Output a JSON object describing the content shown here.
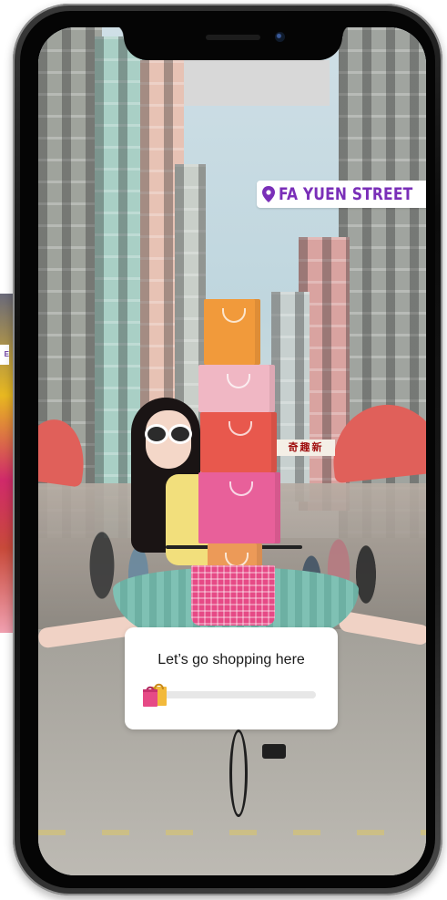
{
  "story": {
    "location_sticker": {
      "label": "FA YUEN STREET",
      "icon": "location-pin-icon",
      "color": "#7a2fb8"
    },
    "poll_sticker": {
      "question": "Let’s go shopping here",
      "slider_value": 0,
      "emoji_icon": "shopping-bags-emoji-icon",
      "track_color": "#e7e7e7"
    },
    "shop_sign": "奇趣新"
  }
}
